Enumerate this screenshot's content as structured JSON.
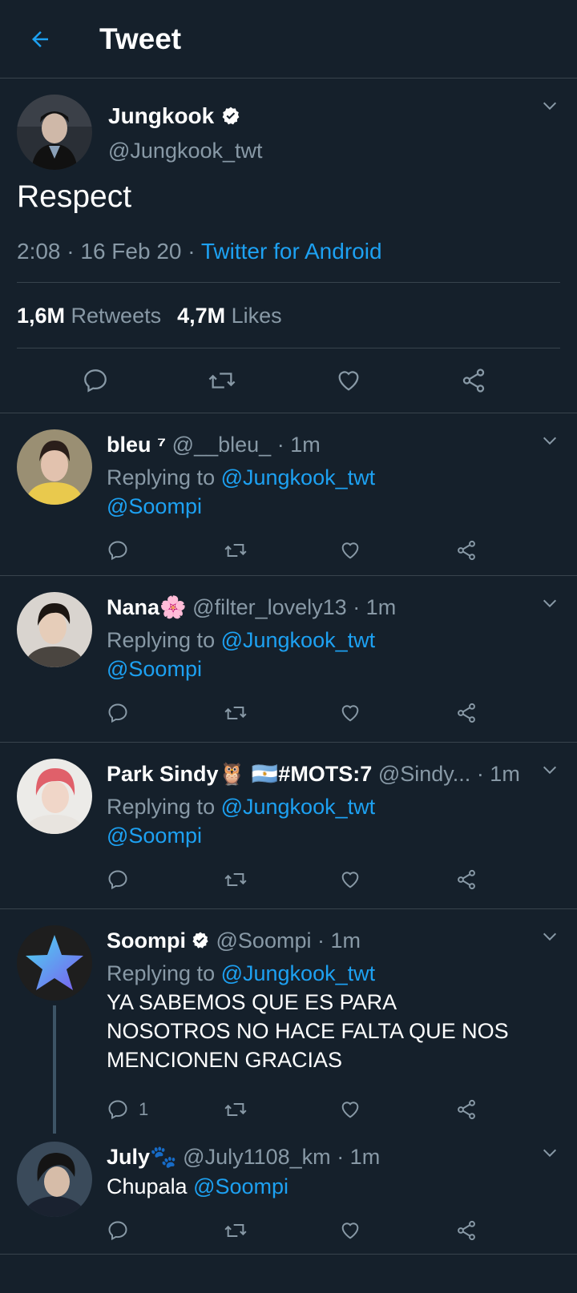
{
  "header": {
    "title": "Tweet"
  },
  "main_tweet": {
    "author_name": "Jungkook",
    "author_handle": "@Jungkook_twt",
    "text": "Respect",
    "time": "2:08 · 16 Feb 20 · ",
    "source": "Twitter for Android",
    "retweets_count": "1,6M",
    "retweets_label": "Retweets",
    "likes_count": "4,7M",
    "likes_label": "Likes"
  },
  "replies": [
    {
      "name": "bleu ⁷",
      "handle": "@__bleu_",
      "time": "· 1m",
      "replying_label": "Replying to ",
      "replying_to": "@Jungkook_twt",
      "text": "",
      "mention": "@Soompi",
      "reply_count": ""
    },
    {
      "name": "Nana🌸",
      "handle": "@filter_lovely13",
      "time": "· 1m",
      "replying_label": "Replying to ",
      "replying_to": "@Jungkook_twt",
      "text": "",
      "mention": "@Soompi",
      "reply_count": ""
    },
    {
      "name": "Park Sindy🦉 🇦🇷#MOTS:7",
      "handle": "@Sindy...",
      "time": "· 1m",
      "replying_label": "Replying to ",
      "replying_to": "@Jungkook_twt",
      "text": "",
      "mention": "@Soompi",
      "reply_count": ""
    },
    {
      "name": "Soompi",
      "handle": "@Soompi",
      "time": "· 1m",
      "replying_label": "Replying to ",
      "replying_to": "@Jungkook_twt",
      "text": "YA SABEMOS QUE ES PARA NOSOTROS NO HACE FALTA QUE NOS MENCIONEN GRACIAS",
      "mention": "",
      "reply_count": "1"
    },
    {
      "name": "July🐾",
      "handle": "@July1108_km",
      "time": "· 1m",
      "replying_label": "",
      "replying_to": "",
      "text": "Chupala ",
      "mention": "@Soompi",
      "reply_count": ""
    }
  ],
  "colors": {
    "background": "#15202b",
    "accent": "#1da1f2",
    "muted": "#8899a6",
    "divider": "#38444d"
  },
  "icons": [
    "back-arrow-icon",
    "verified-badge-icon",
    "chevron-down-icon",
    "reply-icon",
    "retweet-icon",
    "like-icon",
    "share-icon",
    "star-logo-icon"
  ]
}
